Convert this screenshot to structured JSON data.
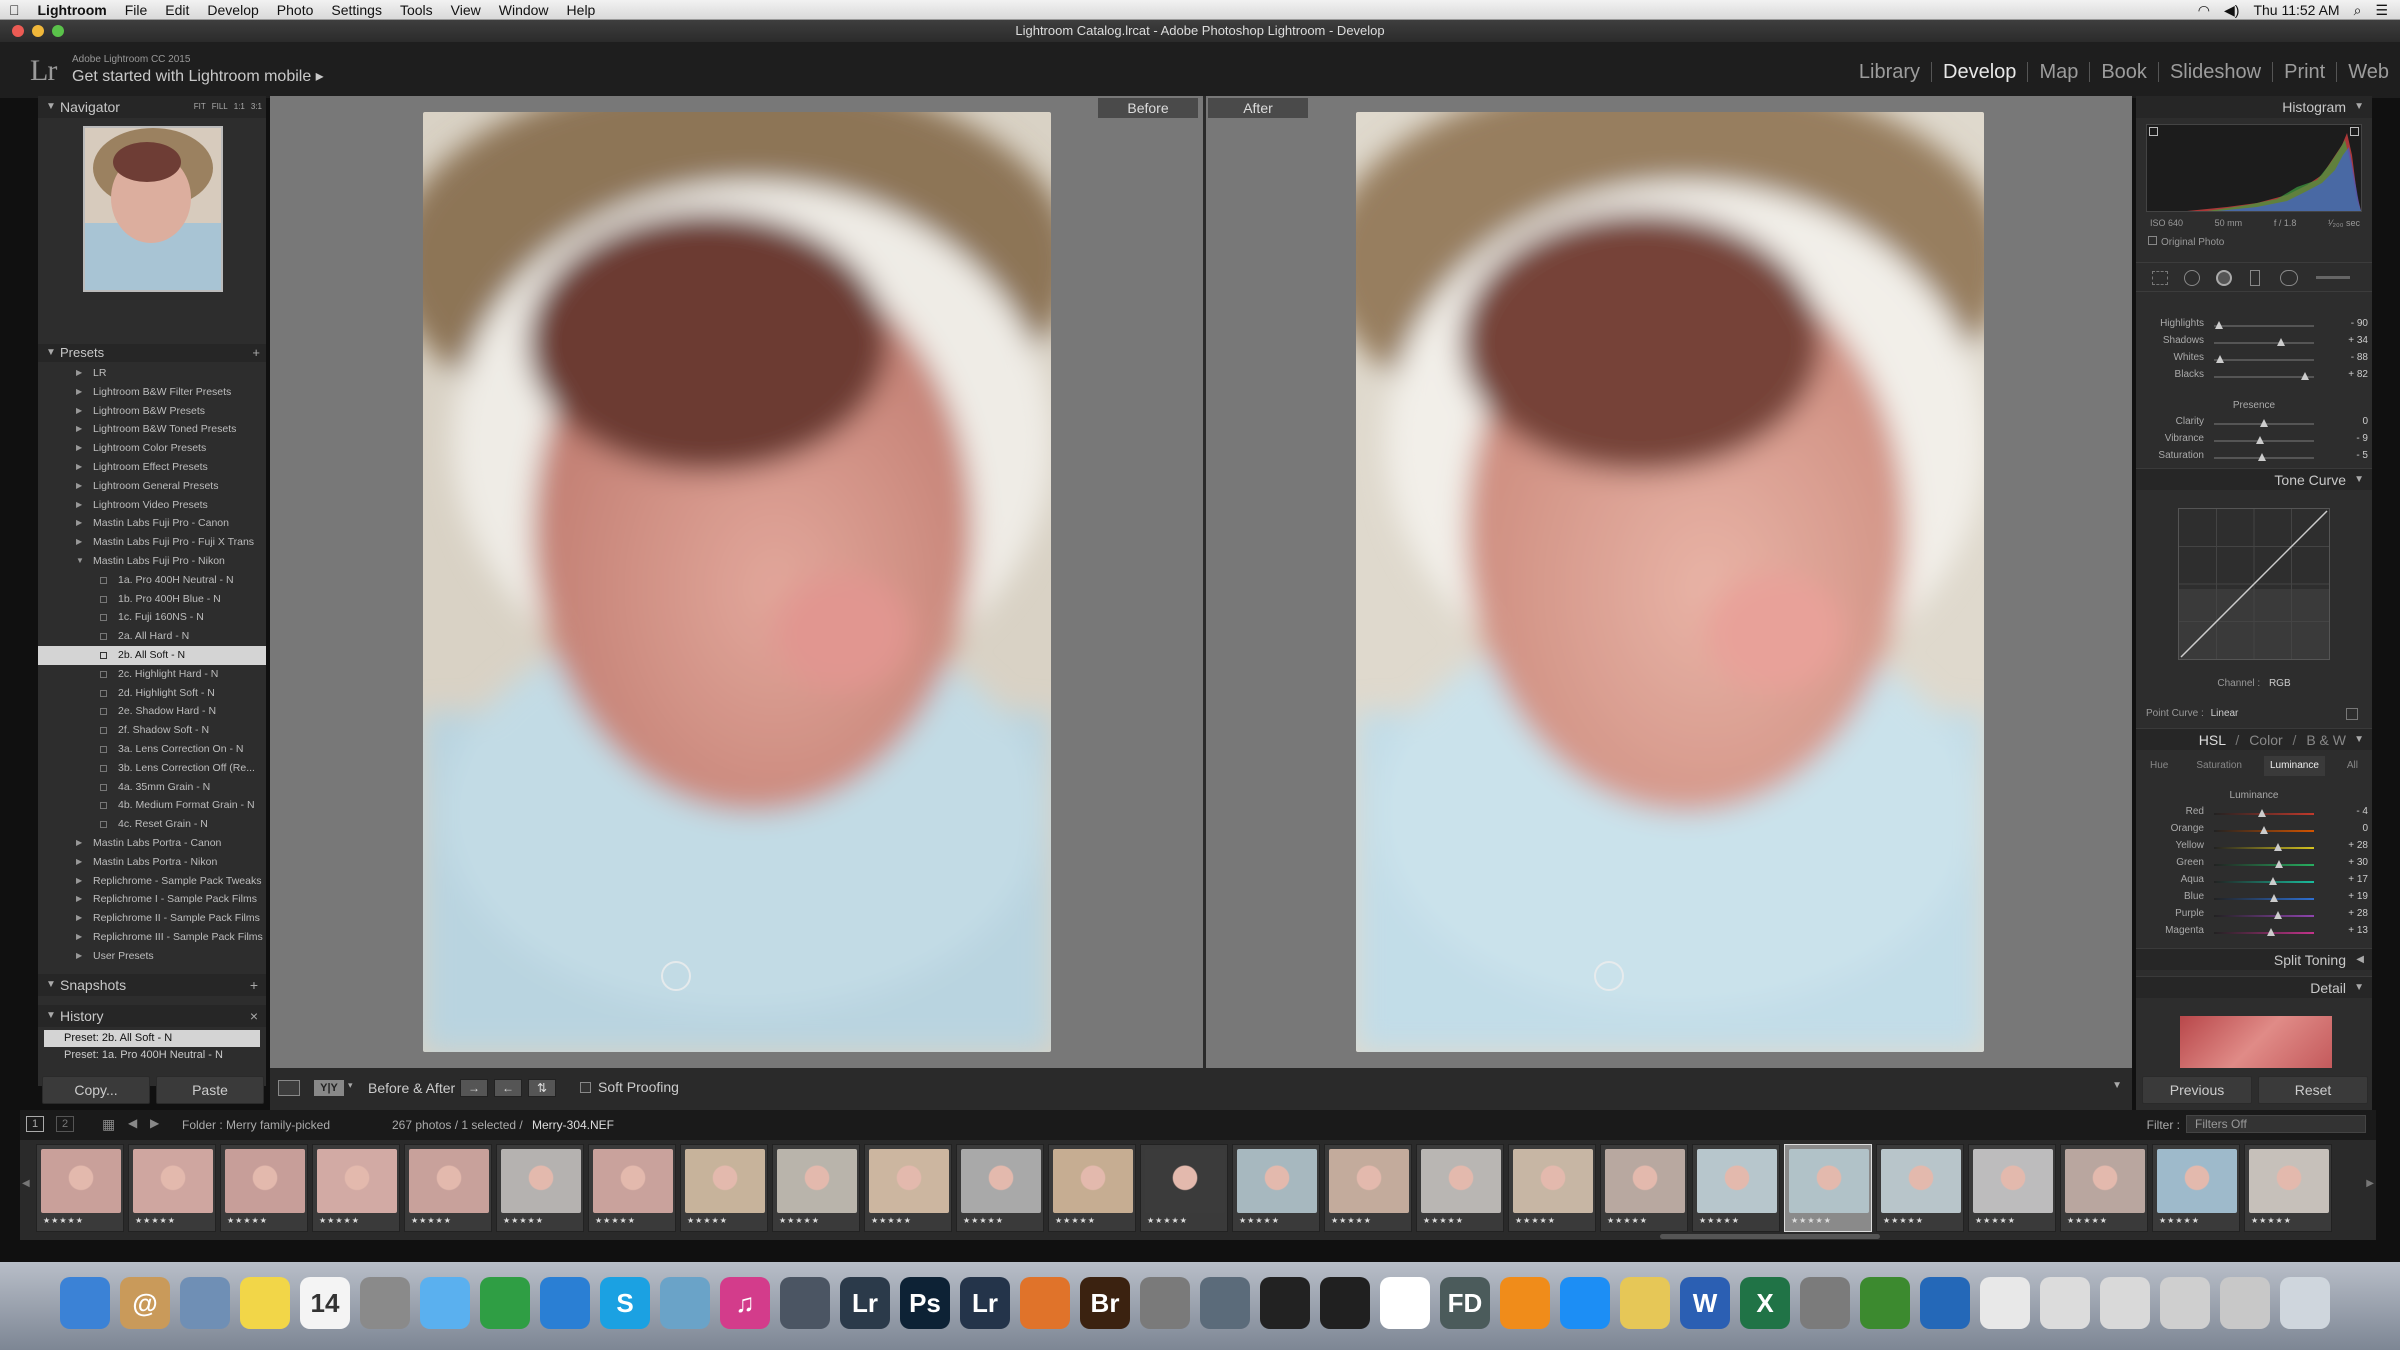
{
  "menubar": {
    "apple": "",
    "app": "Lightroom",
    "items": [
      "File",
      "Edit",
      "Develop",
      "Photo",
      "Settings",
      "Tools",
      "View",
      "Window",
      "Help"
    ],
    "clock": "Thu 11:52 AM"
  },
  "window": {
    "title": "Lightroom Catalog.lrcat - Adobe Photoshop Lightroom - Develop"
  },
  "identity": {
    "logo": "Lr",
    "version": "Adobe Lightroom CC 2015",
    "message": "Get started with Lightroom mobile ▸"
  },
  "modules": [
    "Library",
    "Develop",
    "Map",
    "Book",
    "Slideshow",
    "Print",
    "Web"
  ],
  "active_module": "Develop",
  "navigator": {
    "title": "Navigator",
    "zoom_options": [
      "FIT",
      "FILL",
      "1:1",
      "3:1"
    ]
  },
  "presets": {
    "title": "Presets",
    "items": [
      {
        "label": "LR",
        "level": 0,
        "type": "folder"
      },
      {
        "label": "Lightroom B&W Filter Presets",
        "level": 0,
        "type": "folder"
      },
      {
        "label": "Lightroom B&W Presets",
        "level": 0,
        "type": "folder"
      },
      {
        "label": "Lightroom B&W Toned Presets",
        "level": 0,
        "type": "folder"
      },
      {
        "label": "Lightroom Color Presets",
        "level": 0,
        "type": "folder"
      },
      {
        "label": "Lightroom Effect Presets",
        "level": 0,
        "type": "folder"
      },
      {
        "label": "Lightroom General Presets",
        "level": 0,
        "type": "folder"
      },
      {
        "label": "Lightroom Video Presets",
        "level": 0,
        "type": "folder"
      },
      {
        "label": "Mastin Labs Fuji Pro - Canon",
        "level": 0,
        "type": "folder"
      },
      {
        "label": "Mastin Labs Fuji Pro - Fuji X Trans",
        "level": 0,
        "type": "folder"
      },
      {
        "label": "Mastin Labs Fuji Pro - Nikon",
        "level": 0,
        "type": "open"
      },
      {
        "label": "1a. Pro 400H Neutral - N",
        "level": 1,
        "type": "preset"
      },
      {
        "label": "1b. Pro 400H Blue - N",
        "level": 1,
        "type": "preset"
      },
      {
        "label": "1c. Fuji 160NS - N",
        "level": 1,
        "type": "preset"
      },
      {
        "label": "2a. All Hard - N",
        "level": 1,
        "type": "preset"
      },
      {
        "label": "2b. All Soft - N",
        "level": 1,
        "type": "selected"
      },
      {
        "label": "2c. Highlight Hard - N",
        "level": 1,
        "type": "preset"
      },
      {
        "label": "2d. Highlight Soft - N",
        "level": 1,
        "type": "preset"
      },
      {
        "label": "2e. Shadow Hard - N",
        "level": 1,
        "type": "preset"
      },
      {
        "label": "2f. Shadow Soft - N",
        "level": 1,
        "type": "preset"
      },
      {
        "label": "3a. Lens Correction On - N",
        "level": 1,
        "type": "preset"
      },
      {
        "label": "3b. Lens Correction Off (Re...",
        "level": 1,
        "type": "preset"
      },
      {
        "label": "4a. 35mm Grain - N",
        "level": 1,
        "type": "preset"
      },
      {
        "label": "4b. Medium Format Grain - N",
        "level": 1,
        "type": "preset"
      },
      {
        "label": "4c. Reset Grain - N",
        "level": 1,
        "type": "preset"
      },
      {
        "label": "Mastin Labs Portra - Canon",
        "level": 0,
        "type": "folder"
      },
      {
        "label": "Mastin Labs Portra - Nikon",
        "level": 0,
        "type": "folder"
      },
      {
        "label": "Replichrome - Sample Pack Tweaks",
        "level": 0,
        "type": "folder"
      },
      {
        "label": "Replichrome I - Sample Pack Films",
        "level": 0,
        "type": "folder"
      },
      {
        "label": "Replichrome II - Sample Pack Films",
        "level": 0,
        "type": "folder"
      },
      {
        "label": "Replichrome III - Sample Pack Films",
        "level": 0,
        "type": "folder"
      },
      {
        "label": "User Presets",
        "level": 0,
        "type": "folder"
      }
    ]
  },
  "snapshots": {
    "title": "Snapshots"
  },
  "history": {
    "title": "History",
    "items": [
      "Preset: 2b. All Soft - N",
      "Preset: 1a. Pro 400H Neutral - N"
    ]
  },
  "left_buttons": {
    "copy": "Copy...",
    "paste": "Paste"
  },
  "compare": {
    "before": "Before",
    "after": "After"
  },
  "toolbar": {
    "before_after": "Before & After :",
    "soft_proofing": "Soft Proofing",
    "yy": "Y|Y"
  },
  "right_buttons": {
    "previous": "Previous",
    "reset": "Reset"
  },
  "histogram": {
    "title": "Histogram",
    "iso": "ISO 640",
    "focal": "50 mm",
    "aperture": "f / 1.8",
    "shutter": "¹⁄₂₀₀ sec",
    "original_photo": "Original Photo"
  },
  "basic_tone": [
    {
      "label": "Highlights",
      "value": "- 90",
      "pos": 0.05
    },
    {
      "label": "Shadows",
      "value": "+ 34",
      "pos": 0.67
    },
    {
      "label": "Whites",
      "value": "- 88",
      "pos": 0.06
    },
    {
      "label": "Blacks",
      "value": "+ 82",
      "pos": 0.91
    }
  ],
  "presence": {
    "title": "Presence",
    "sliders": [
      {
        "label": "Clarity",
        "value": "0",
        "pos": 0.5
      },
      {
        "label": "Vibrance",
        "value": "- 9",
        "pos": 0.455
      },
      {
        "label": "Saturation",
        "value": "- 5",
        "pos": 0.475
      }
    ]
  },
  "tone_curve": {
    "title": "Tone Curve",
    "channel_label": "Channel :",
    "channel": "RGB",
    "point_curve_label": "Point Curve :",
    "point_curve": "Linear"
  },
  "hsl": {
    "title_hsl": "HSL",
    "sep": "/",
    "title_color": "Color",
    "title_bw": "B & W",
    "tabs": [
      "Hue",
      "Saturation",
      "Luminance",
      "All"
    ],
    "active_tab": "Luminance",
    "section": "Luminance",
    "sliders": [
      {
        "label": "Red",
        "value": "- 4",
        "pos": 0.48,
        "color": "#c0392b"
      },
      {
        "label": "Orange",
        "value": "0",
        "pos": 0.5,
        "color": "#d35400"
      },
      {
        "label": "Yellow",
        "value": "+ 28",
        "pos": 0.64,
        "color": "#d4c21f"
      },
      {
        "label": "Green",
        "value": "+ 30",
        "pos": 0.65,
        "color": "#27ae60"
      },
      {
        "label": "Aqua",
        "value": "+ 17",
        "pos": 0.585,
        "color": "#1abc9c"
      },
      {
        "label": "Blue",
        "value": "+ 19",
        "pos": 0.595,
        "color": "#2d6fd1"
      },
      {
        "label": "Purple",
        "value": "+ 28",
        "pos": 0.64,
        "color": "#8e44ad"
      },
      {
        "label": "Magenta",
        "value": "+ 13",
        "pos": 0.565,
        "color": "#c2338b"
      }
    ]
  },
  "split_toning": {
    "title": "Split Toning"
  },
  "detail": {
    "title": "Detail"
  },
  "filmbar": {
    "pages": [
      "1",
      "2"
    ],
    "folder": "Folder : Merry family-picked",
    "count": "267 photos / 1 selected /",
    "filename": "Merry-304.NEF",
    "filter_label": "Filter :",
    "filter_value": "Filters Off"
  },
  "thumbnails": [
    {
      "tone": "#c9a09a",
      "stars": "★★★★★"
    },
    {
      "tone": "#cfa6a0",
      "stars": "★★★★★"
    },
    {
      "tone": "#c79e99",
      "stars": "★★★★★"
    },
    {
      "tone": "#d2aaa4",
      "stars": "★★★★★"
    },
    {
      "tone": "#c8a19b",
      "stars": "★★★★★"
    },
    {
      "tone": "#b5b2b0",
      "stars": "★★★★★"
    },
    {
      "tone": "#c9a29c",
      "stars": "★★★★★"
    },
    {
      "tone": "#c7b39b",
      "stars": "★★★★★"
    },
    {
      "tone": "#b9b4ab",
      "stars": "★★★★★"
    },
    {
      "tone": "#ccb6a0",
      "stars": "★★★★★"
    },
    {
      "tone": "#a9a9a9",
      "stars": "★★★★★"
    },
    {
      "tone": "#c6ad92",
      "stars": "★★★★★"
    },
    {
      "tone": "#3b3b3b",
      "stars": "★★★★★"
    },
    {
      "tone": "#a7b8bf",
      "stars": "★★★★★"
    },
    {
      "tone": "#c3ab9c",
      "stars": "★★★★★"
    },
    {
      "tone": "#b9b6b3",
      "stars": "★★★★★"
    },
    {
      "tone": "#c7b6a4",
      "stars": "★★★★★"
    },
    {
      "tone": "#b8a8a0",
      "stars": "★★★★★"
    },
    {
      "tone": "#b7c6cc",
      "stars": "★★★★★"
    },
    {
      "tone": "#b1c2c8",
      "stars": "★★★★★"
    },
    {
      "tone": "#b8c5ca",
      "stars": "★★★★★"
    },
    {
      "tone": "#bdbcbd",
      "stars": "★★★★★"
    },
    {
      "tone": "#b9a69f",
      "stars": "★★★★★"
    },
    {
      "tone": "#9ebacb",
      "stars": "★★★★★"
    },
    {
      "tone": "#c6c0ba",
      "stars": "★★★★★"
    }
  ],
  "selected_thumbnail": 19,
  "dock": [
    {
      "name": "finder-icon",
      "glyph": "",
      "bg": "#3b82d6"
    },
    {
      "name": "contacts-icon",
      "glyph": "@",
      "bg": "#c99a5a"
    },
    {
      "name": "preview-icon",
      "glyph": "",
      "bg": "#6f8fb5"
    },
    {
      "name": "stickies-icon",
      "glyph": "",
      "bg": "#f2d648"
    },
    {
      "name": "calendar-icon",
      "glyph": "14",
      "bg": "#f4f4f4"
    },
    {
      "name": "calculator-icon",
      "glyph": "",
      "bg": "#8a8a8a"
    },
    {
      "name": "messages-icon",
      "glyph": "",
      "bg": "#5ab0ef"
    },
    {
      "name": "chrome-icon",
      "glyph": "",
      "bg": "#2f9e44"
    },
    {
      "name": "safari-icon",
      "glyph": "",
      "bg": "#2a7fd4"
    },
    {
      "name": "skype-icon",
      "glyph": "S",
      "bg": "#1ba1e2"
    },
    {
      "name": "photos-icon",
      "glyph": "",
      "bg": "#6aa3c8"
    },
    {
      "name": "itunes-icon",
      "glyph": "♫",
      "bg": "#d33c8b"
    },
    {
      "name": "aperture-icon",
      "glyph": "",
      "bg": "#4b5563"
    },
    {
      "name": "lightroom-icon",
      "glyph": "Lr",
      "bg": "#2b3a4a"
    },
    {
      "name": "photoshop-icon",
      "glyph": "Ps",
      "bg": "#0d2235"
    },
    {
      "name": "lightroom-cc-icon",
      "glyph": "Lr",
      "bg": "#24344a"
    },
    {
      "name": "acrobat-icon",
      "glyph": "",
      "bg": "#e0732a"
    },
    {
      "name": "bridge-icon",
      "glyph": "Br",
      "bg": "#3b2210"
    },
    {
      "name": "utilities-icon",
      "glyph": "",
      "bg": "#7a7a7a"
    },
    {
      "name": "screenshot-icon",
      "glyph": "",
      "bg": "#5b6b7a"
    },
    {
      "name": "creative-cloud-icon",
      "glyph": "",
      "bg": "#222222"
    },
    {
      "name": "stocks-icon",
      "glyph": "",
      "bg": "#202020"
    },
    {
      "name": "home-icon",
      "glyph": "",
      "bg": "#ffffff"
    },
    {
      "name": "fd-icon",
      "glyph": "FD",
      "bg": "#4b5b5b"
    },
    {
      "name": "ibooks-icon",
      "glyph": "",
      "bg": "#f08c1a"
    },
    {
      "name": "appstore-icon",
      "glyph": "",
      "bg": "#1c8ef5"
    },
    {
      "name": "notes-icon",
      "glyph": "",
      "bg": "#e6c757"
    },
    {
      "name": "word-icon",
      "glyph": "W",
      "bg": "#2b5fb3"
    },
    {
      "name": "excel-icon",
      "glyph": "X",
      "bg": "#207346"
    },
    {
      "name": "system-preferences-icon",
      "glyph": "",
      "bg": "#7b7b7b"
    },
    {
      "name": "time-machine-icon",
      "glyph": "",
      "bg": "#3c8a2f"
    },
    {
      "name": "quicktime-icon",
      "glyph": "",
      "bg": "#2468b8"
    },
    {
      "name": "documents-icon",
      "glyph": "",
      "bg": "#e8e8e8"
    },
    {
      "name": "downloads-icon",
      "glyph": "",
      "bg": "#dcdcdc"
    },
    {
      "name": "files-icon",
      "glyph": "",
      "bg": "#d9d9d9"
    },
    {
      "name": "grid-icon",
      "glyph": "",
      "bg": "#cfcfcf"
    },
    {
      "name": "stack-icon",
      "glyph": "",
      "bg": "#c8c8c8"
    },
    {
      "name": "trash-icon",
      "glyph": "",
      "bg": "#cfd6dd"
    }
  ]
}
